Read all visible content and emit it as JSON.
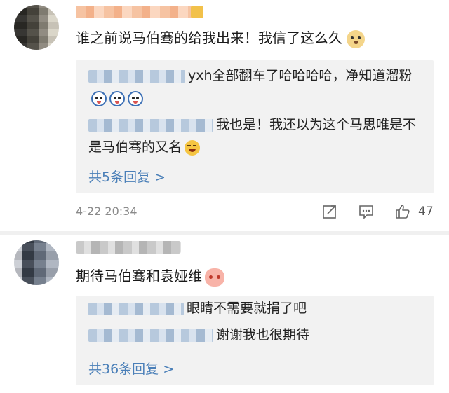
{
  "comments": [
    {
      "text": "谁之前说马伯骞的给我出来！我信了这么久",
      "emoji": "doge-emoji",
      "replies": [
        {
          "text": "yxh全部翻车了哈哈哈哈，净知道溜粉",
          "emoji": "shocked-emoji"
        },
        {
          "text": "我也是！我还以为这个马思唯是不是马伯骞的又名",
          "emoji": "laugh-cry-emoji"
        }
      ],
      "more_replies": "共5条回复 >",
      "timestamp": "4-22 20:34",
      "likes": "47"
    },
    {
      "text": "期待马伯骞和袁娅维",
      "emoji": "shy-emoji",
      "replies": [
        {
          "text": "眼睛不需要就捐了吧"
        },
        {
          "text": "谢谢我也很期待"
        }
      ],
      "more_replies": "共36条回复 >"
    }
  ],
  "colors": {
    "link_blue": "#4a7fb8",
    "reply_bg": "#f2f2f2",
    "meta_gray": "#8a8a8a"
  },
  "icons": [
    "share-icon",
    "comment-icon",
    "like-icon"
  ]
}
